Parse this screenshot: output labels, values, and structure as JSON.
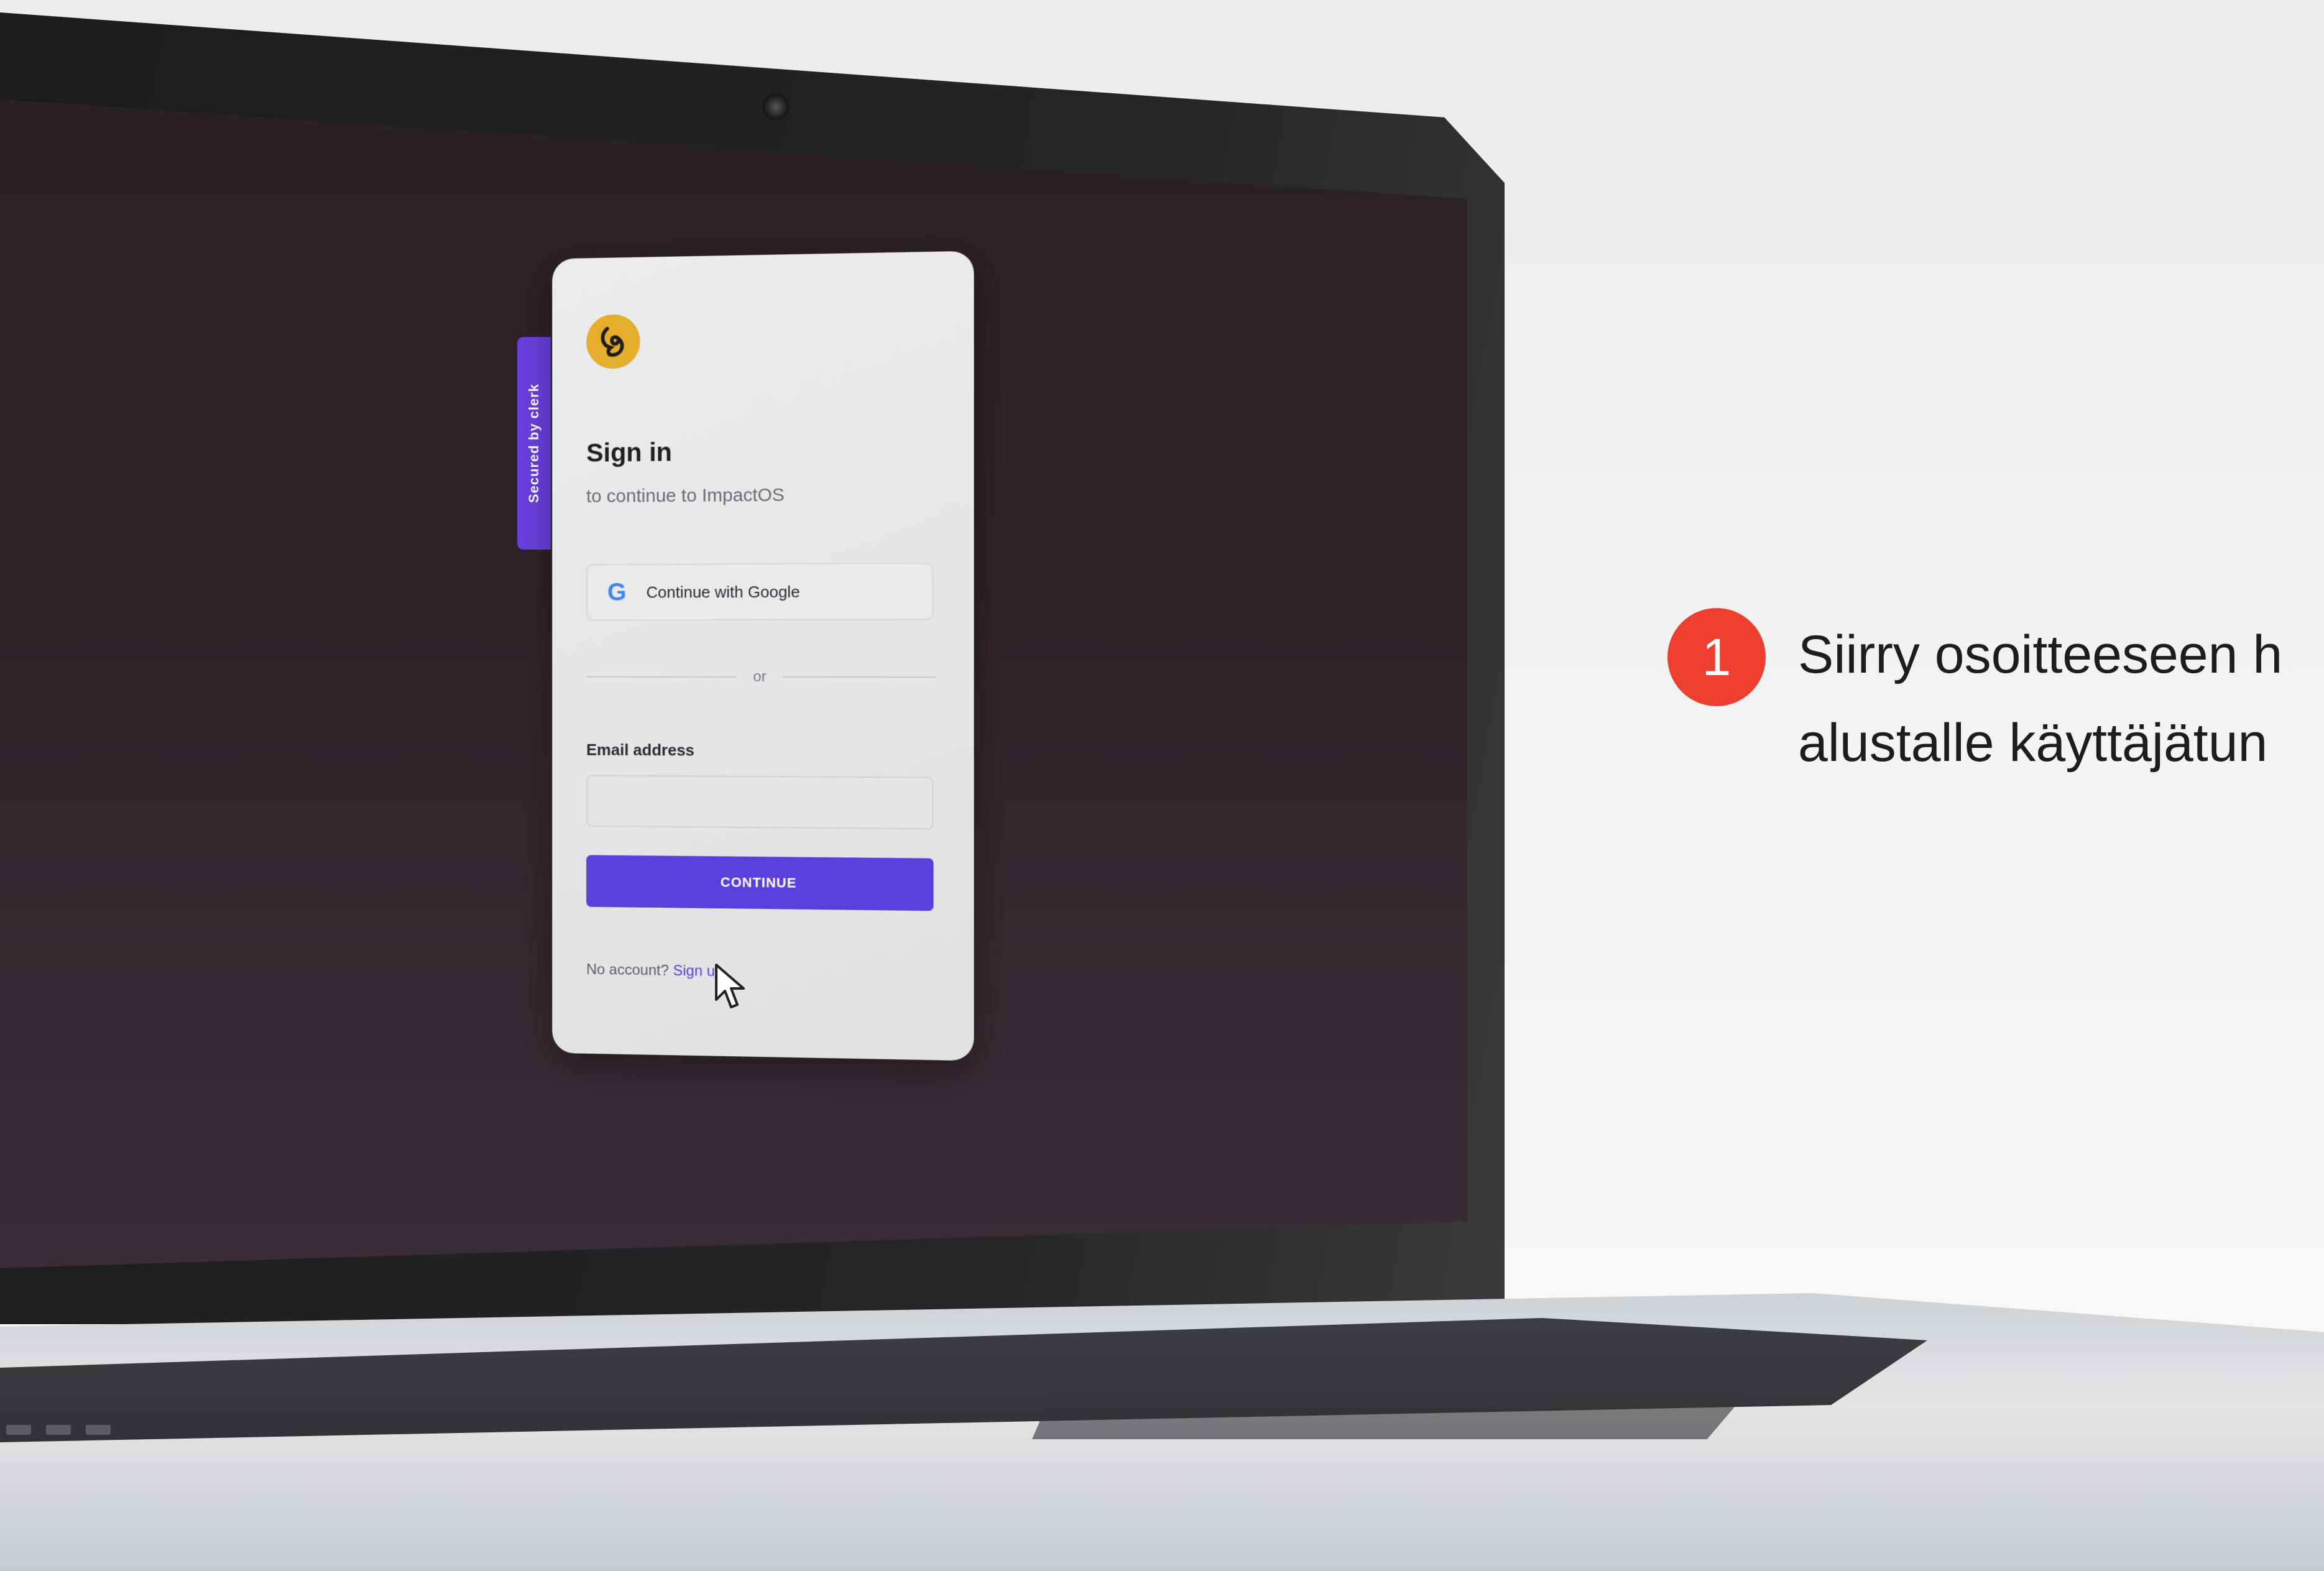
{
  "clerk_tab": {
    "label": "Secured by  clerk"
  },
  "sign_in": {
    "title": "Sign in",
    "subtitle": "to continue to ImpactOS",
    "google_button": "Continue with Google",
    "divider": "or",
    "email_label": "Email address",
    "email_value": "",
    "continue_button": "CONTINUE",
    "no_account": "No account?",
    "sign_up": "Sign up"
  },
  "instruction": {
    "step": "1",
    "line1": "Siirry osoitteeseen h",
    "line2": "alustalle käyttäjätun"
  },
  "colors": {
    "brand_purple": "#5b3fdc",
    "step_red": "#ee3f2e",
    "logo_gold": "#e5ad2c"
  },
  "icons": [
    "camera-icon",
    "app-logo-icon",
    "google-icon",
    "cursor-icon"
  ]
}
